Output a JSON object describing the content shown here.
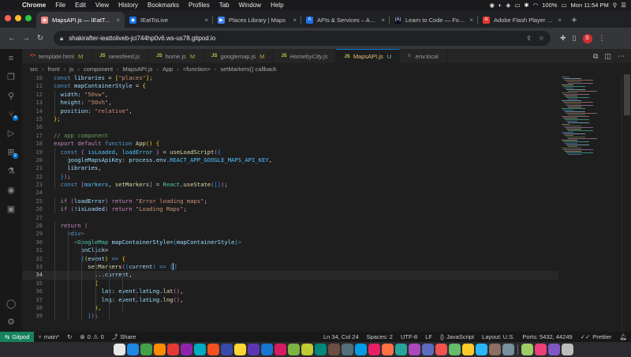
{
  "menubar": {
    "app": "Chrome",
    "items": [
      "File",
      "Edit",
      "View",
      "History",
      "Bookmarks",
      "Profiles",
      "Tab",
      "Window",
      "Help"
    ],
    "battery": "100%",
    "datetime": "Mon 11:54 PM"
  },
  "tabs": [
    {
      "title": "MapsAPI.js — IEatToLive",
      "color": "#f28b82",
      "glyph": "◆"
    },
    {
      "title": "IEatToLive",
      "color": "#1a73e8",
      "glyph": "◆"
    },
    {
      "title": "Places Library  |  Maps",
      "color": "#4285f4",
      "glyph": "▶"
    },
    {
      "title": "APIs & Services – APIs",
      "color": "#1a73e8",
      "glyph": "A"
    },
    {
      "title": "Learn to Code — For Free",
      "color": "#0a0a23",
      "glyph": "(A)"
    },
    {
      "title": "Adobe Flash Player End",
      "color": "#e53935",
      "glyph": "A"
    }
  ],
  "address": {
    "url": "shakirafter-ieattoliveb-jci744hp0v6.ws-us78.gitpod.io",
    "profile_initial": "S"
  },
  "editor_tabs": [
    {
      "name": "template.html",
      "icon": "<>",
      "icon_color": "#e44d26",
      "flag": "M",
      "active": false,
      "italic": false
    },
    {
      "name": "newsfeed.js",
      "icon": "JS",
      "icon_color": "#cbcb41",
      "flag": "",
      "active": false,
      "italic": false
    },
    {
      "name": "home.js",
      "icon": "JS",
      "icon_color": "#cbcb41",
      "flag": "M",
      "active": false,
      "italic": false
    },
    {
      "name": "googlemap.js",
      "icon": "JS",
      "icon_color": "#cbcb41",
      "flag": "M",
      "active": false,
      "italic": false
    },
    {
      "name": "HomebyCity.js",
      "icon": "JS",
      "icon_color": "#cbcb41",
      "flag": "",
      "active": false,
      "italic": true
    },
    {
      "name": "MapsAPI.js",
      "icon": "JS",
      "icon_color": "#cbcb41",
      "flag": "U",
      "active": true,
      "italic": false
    },
    {
      "name": ".env.local",
      "icon": "≡",
      "icon_color": "#9d9d9d",
      "flag": "",
      "active": false,
      "italic": false
    }
  ],
  "breadcrumb": [
    "src",
    "front",
    "js",
    "component",
    "MapsAPI.js",
    "App",
    "<function>",
    "setMarkers() callback"
  ],
  "code": {
    "current_line": 34,
    "lines": [
      {
        "n": 10,
        "indent": 0,
        "t": [
          [
            "b",
            "const "
          ],
          [
            "v",
            "libraries"
          ],
          [
            "p",
            " = "
          ],
          [
            "br",
            "["
          ],
          [
            "s",
            "\"places\""
          ],
          [
            "br",
            "]"
          ],
          [
            "p",
            ";"
          ]
        ]
      },
      {
        "n": 11,
        "indent": 0,
        "t": [
          [
            "b",
            "const "
          ],
          [
            "v",
            "mapContainerStyle"
          ],
          [
            "p",
            " = "
          ],
          [
            "br",
            "{"
          ]
        ]
      },
      {
        "n": 12,
        "indent": 1,
        "t": [
          [
            "v",
            "width"
          ],
          [
            "p",
            ": "
          ],
          [
            "s",
            "\"50vw\""
          ],
          [
            "p",
            ","
          ]
        ]
      },
      {
        "n": 13,
        "indent": 1,
        "t": [
          [
            "v",
            "height"
          ],
          [
            "p",
            ": "
          ],
          [
            "s",
            "\"50vh\""
          ],
          [
            "p",
            ","
          ]
        ]
      },
      {
        "n": 14,
        "indent": 1,
        "t": [
          [
            "v",
            "position"
          ],
          [
            "p",
            ": "
          ],
          [
            "s",
            "\"relative\""
          ],
          [
            "p",
            ","
          ]
        ]
      },
      {
        "n": 15,
        "indent": 0,
        "t": [
          [
            "br",
            "}"
          ],
          [
            "p",
            ";"
          ]
        ]
      },
      {
        "n": 16,
        "indent": 0,
        "t": []
      },
      {
        "n": 17,
        "indent": 0,
        "t": [
          [
            "c",
            "// app component"
          ]
        ]
      },
      {
        "n": 18,
        "indent": 0,
        "t": [
          [
            "k",
            "export default "
          ],
          [
            "b",
            "function "
          ],
          [
            "f",
            "App"
          ],
          [
            "br",
            "()"
          ],
          [
            "p",
            " "
          ],
          [
            "br",
            "{"
          ]
        ]
      },
      {
        "n": 19,
        "indent": 1,
        "t": [
          [
            "b",
            "const "
          ],
          [
            "br2",
            "{ "
          ],
          [
            "cn",
            "isLoaded"
          ],
          [
            "p",
            ", "
          ],
          [
            "cn",
            "loadError"
          ],
          [
            "br2",
            " }"
          ],
          [
            "p",
            " = "
          ],
          [
            "f",
            "useLoadScript"
          ],
          [
            "br2",
            "("
          ],
          [
            "br3",
            "{"
          ]
        ]
      },
      {
        "n": 20,
        "indent": 2,
        "t": [
          [
            "v",
            "googleMapsApiKey"
          ],
          [
            "p",
            ": "
          ],
          [
            "v",
            "process"
          ],
          [
            "p",
            "."
          ],
          [
            "v",
            "env"
          ],
          [
            "p",
            "."
          ],
          [
            "cn",
            "REACT_APP_GOOGLE_MAPS_API_KEY"
          ],
          [
            "p",
            ","
          ]
        ]
      },
      {
        "n": 21,
        "indent": 2,
        "t": [
          [
            "v",
            "libraries"
          ],
          [
            "p",
            ","
          ]
        ]
      },
      {
        "n": 22,
        "indent": 1,
        "t": [
          [
            "br3",
            "}"
          ],
          [
            "br2",
            ")"
          ],
          [
            "p",
            ";"
          ]
        ]
      },
      {
        "n": 23,
        "indent": 1,
        "t": [
          [
            "b",
            "const "
          ],
          [
            "br2",
            "["
          ],
          [
            "cn",
            "markers"
          ],
          [
            "p",
            ", "
          ],
          [
            "f",
            "setMarkers"
          ],
          [
            "br2",
            "]"
          ],
          [
            "p",
            " = "
          ],
          [
            "t",
            "React"
          ],
          [
            "p",
            "."
          ],
          [
            "f",
            "useState"
          ],
          [
            "br2",
            "("
          ],
          [
            "br3",
            "[]"
          ],
          [
            "br2",
            ")"
          ],
          [
            "p",
            ";"
          ]
        ]
      },
      {
        "n": 24,
        "indent": 0,
        "t": []
      },
      {
        "n": 25,
        "indent": 1,
        "t": [
          [
            "k",
            "if "
          ],
          [
            "br2",
            "("
          ],
          [
            "v",
            "loadError"
          ],
          [
            "br2",
            ")"
          ],
          [
            "k",
            " return "
          ],
          [
            "s",
            "\"Error loading maps\""
          ],
          [
            "p",
            ";"
          ]
        ]
      },
      {
        "n": 26,
        "indent": 1,
        "t": [
          [
            "k",
            "if "
          ],
          [
            "br2",
            "("
          ],
          [
            "p",
            "!"
          ],
          [
            "v",
            "isLoaded"
          ],
          [
            "br2",
            ")"
          ],
          [
            "k",
            " return "
          ],
          [
            "s",
            "\"Loading Maps\""
          ],
          [
            "p",
            ";"
          ]
        ]
      },
      {
        "n": 27,
        "indent": 0,
        "t": []
      },
      {
        "n": 28,
        "indent": 1,
        "t": [
          [
            "k",
            "return "
          ],
          [
            "br2",
            "("
          ]
        ]
      },
      {
        "n": 29,
        "indent": 2,
        "t": [
          [
            "tb",
            "<"
          ],
          [
            "tg",
            "div"
          ],
          [
            "tb",
            ">"
          ]
        ]
      },
      {
        "n": 30,
        "indent": 3,
        "t": [
          [
            "tb",
            "<"
          ],
          [
            "t",
            "GoogleMap"
          ],
          [
            "p",
            " "
          ],
          [
            "at",
            "mapContainerStyle"
          ],
          [
            "p",
            "="
          ],
          [
            "br3",
            "{"
          ],
          [
            "v",
            "mapContainerStyle"
          ],
          [
            "br3",
            "}"
          ],
          [
            "tb",
            ">"
          ]
        ]
      },
      {
        "n": 31,
        "indent": 4,
        "t": [
          [
            "at",
            "onClick"
          ],
          [
            "p",
            "="
          ]
        ]
      },
      {
        "n": 32,
        "indent": 4,
        "t": [
          [
            "br3",
            "{"
          ],
          [
            "br",
            "("
          ],
          [
            "v",
            "event"
          ],
          [
            "br",
            ")"
          ],
          [
            "b",
            " => "
          ],
          [
            "br",
            "{"
          ]
        ]
      },
      {
        "n": 33,
        "indent": 5,
        "t": [
          [
            "f",
            "setMarkers"
          ],
          [
            "br2",
            "("
          ],
          [
            "br3",
            "("
          ],
          [
            "v",
            "current"
          ],
          [
            "br3",
            ")"
          ],
          [
            "b",
            " => "
          ],
          [
            "br3",
            "[|]"
          ]
        ]
      },
      {
        "n": 34,
        "indent": 6,
        "t": [
          [
            "p",
            "..."
          ],
          [
            "v",
            "current"
          ],
          [
            "p",
            ","
          ]
        ]
      },
      {
        "n": 35,
        "indent": 6,
        "t": [
          [
            "br",
            "{"
          ]
        ]
      },
      {
        "n": 36,
        "indent": 7,
        "t": [
          [
            "v",
            "lat"
          ],
          [
            "p",
            ": "
          ],
          [
            "v",
            "event"
          ],
          [
            "p",
            "."
          ],
          [
            "v",
            "latLng"
          ],
          [
            "p",
            "."
          ],
          [
            "f",
            "lat"
          ],
          [
            "br2",
            "()"
          ],
          [
            "p",
            ","
          ]
        ]
      },
      {
        "n": 37,
        "indent": 7,
        "t": [
          [
            "v",
            "lng"
          ],
          [
            "p",
            ": "
          ],
          [
            "v",
            "event"
          ],
          [
            "p",
            "."
          ],
          [
            "v",
            "latLng"
          ],
          [
            "p",
            "."
          ],
          [
            "f",
            "lng"
          ],
          [
            "br2",
            "()"
          ],
          [
            "p",
            ","
          ]
        ]
      },
      {
        "n": 38,
        "indent": 6,
        "t": [
          [
            "br",
            "}"
          ],
          [
            "p",
            ","
          ]
        ]
      },
      {
        "n": 39,
        "indent": 5,
        "t": [
          [
            "br3",
            "]"
          ],
          [
            "br2",
            ")"
          ],
          [
            "p",
            ";"
          ]
        ]
      }
    ]
  },
  "status": {
    "remote": "Gitpod",
    "branch": "main*",
    "errors": "0",
    "warnings": "0",
    "share": "Share",
    "position": "Ln 34, Col 24",
    "spaces": "Spaces: 2",
    "encoding": "UTF-8",
    "eol": "LF",
    "language": "JavaScript",
    "layout": "Layout: U.S.",
    "ports": "Ports: 5432, 44249",
    "formatter": "Prettier"
  },
  "activity": {
    "scm_badge": "4",
    "ext_badge": "2"
  },
  "dock_colors": [
    "#e8e8e8",
    "#1e88e5",
    "#43a047",
    "#fb8c00",
    "#e53935",
    "#8e24aa",
    "#00acc1",
    "#f4511e",
    "#3949ab",
    "#fdd835",
    "#5e35b1",
    "#1976d2",
    "#d81b60",
    "#7cb342",
    "#c0ca33",
    "#00897b",
    "#6d4c41",
    "#546e7a",
    "#039be5",
    "#e91e63",
    "#ff7043",
    "#26a69a",
    "#ab47bc",
    "#5c6bc0",
    "#ef5350",
    "#66bb6a",
    "#ffca28",
    "#29b6f6",
    "#8d6e63",
    "#78909c",
    "#9ccc65",
    "#ec407a",
    "#7e57c2",
    "#bdbdbd"
  ]
}
